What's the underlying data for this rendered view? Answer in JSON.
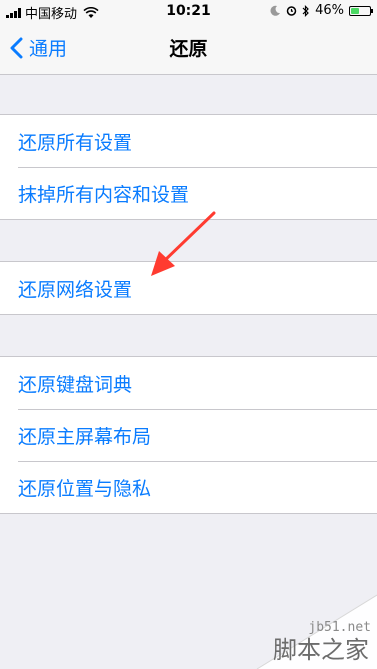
{
  "status_bar": {
    "carrier": "中国移动",
    "time": "10:21",
    "battery_text": "46%",
    "battery_level": 0.46,
    "battery_color": "#4cd964"
  },
  "nav": {
    "back_label": "通用",
    "title": "还原"
  },
  "groups": [
    {
      "items": [
        {
          "label": "还原所有设置"
        },
        {
          "label": "抹掉所有内容和设置"
        }
      ]
    },
    {
      "items": [
        {
          "label": "还原网络设置"
        }
      ]
    },
    {
      "items": [
        {
          "label": "还原键盘词典"
        },
        {
          "label": "还原主屏幕布局"
        },
        {
          "label": "还原位置与隐私"
        }
      ]
    }
  ],
  "watermark": {
    "site": "jb51.net",
    "text": "脚本之家"
  },
  "colors": {
    "accent": "#0a7cff",
    "annotation_arrow": "#ff3b30"
  }
}
